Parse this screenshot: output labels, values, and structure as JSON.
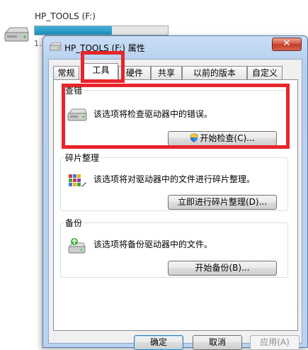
{
  "explorer": {
    "drive_name": "HP_TOOLS (F:)",
    "capacity_prefix": "1.",
    "capacity_fraction": 0.58
  },
  "dialog": {
    "title": "HP_TOOLS (F:) 属性",
    "close_glyph": "✕"
  },
  "tabs": [
    {
      "label": "常规"
    },
    {
      "label": "工具",
      "active": true
    },
    {
      "label": "硬件"
    },
    {
      "label": "共享"
    },
    {
      "label": "以前的版本"
    },
    {
      "label": "自定义"
    }
  ],
  "groups": {
    "error_check": {
      "legend": "查错",
      "description": "该选项将检查驱动器中的错误。",
      "button": "开始检查(C)...",
      "icon": "drive-icon"
    },
    "defrag": {
      "legend": "碎片整理",
      "description": "该选项将对驱动器中的文件进行碎片整理。",
      "button": "立即进行碎片整理(D)...",
      "icon": "defrag-icon"
    },
    "backup": {
      "legend": "备份",
      "description": "该选项将备份驱动器中的文件。",
      "button": "开始备份(B)...",
      "icon": "backup-icon"
    }
  },
  "footer": {
    "ok": "确定",
    "cancel": "取消",
    "apply": "应用(A)"
  },
  "colors": {
    "highlight": "#e8242a",
    "title_bar": "#c9def5",
    "close_button": "#c23a26"
  }
}
